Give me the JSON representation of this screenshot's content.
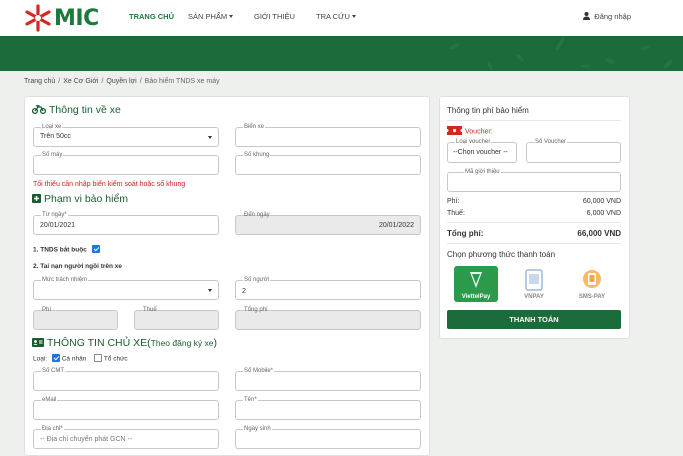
{
  "header": {
    "logo_text": "MIC",
    "nav": [
      {
        "label": "TRANG CHỦ",
        "active": true,
        "dropdown": false
      },
      {
        "label": "SẢN PHẨM",
        "active": false,
        "dropdown": true
      },
      {
        "label": "GIỚI THIỆU",
        "active": false,
        "dropdown": false
      },
      {
        "label": "TRA CỨU",
        "active": false,
        "dropdown": true
      }
    ],
    "login": "Đăng nhập"
  },
  "breadcrumb": [
    "Trang chủ",
    "Xe Cơ Giới",
    "Quyền lợi",
    "Bảo hiểm TNDS xe máy"
  ],
  "vehicle": {
    "title": "Thông tin về xe",
    "loai_xe": {
      "label": "Loại xe",
      "value": "Trên 50cc"
    },
    "bien_xe": {
      "label": "Biển xe",
      "value": ""
    },
    "so_may": {
      "label": "Số máy",
      "value": ""
    },
    "so_khung": {
      "label": "Số khung",
      "value": ""
    },
    "error": "Tối thiểu cần nhập biển kiểm soát hoặc số khung"
  },
  "scope": {
    "title": "Phạm vi bảo hiểm",
    "tu_ngay": {
      "label": "Từ ngày*",
      "value": "20/01/2021"
    },
    "den_ngay": {
      "label": "Đến ngày",
      "value": "20/01/2022"
    },
    "tnds_label": "1. TNDS bắt buộc",
    "tnds_checked": true,
    "accident_label": "2. Tai nạn người ngồi trên xe",
    "muc_trach_nhiem": {
      "label": "Mức trách nhiệm",
      "value": ""
    },
    "so_nguoi": {
      "label": "Số người",
      "value": "2"
    },
    "phi": {
      "label": "Phí",
      "value": ""
    },
    "thue": {
      "label": "Thuế",
      "value": ""
    },
    "tong_phi": {
      "label": "Tổng phí",
      "value": ""
    }
  },
  "owner": {
    "title": "THÔNG TIN CHỦ XE(",
    "title_small": "Theo đăng ký xe",
    "title_end": ")",
    "loai_label": "Loại:",
    "ca_nhan": "Cá nhân",
    "ca_nhan_checked": true,
    "to_chuc": "Tổ chức",
    "to_chuc_checked": false,
    "so_cmt": {
      "label": "Số CMT",
      "value": ""
    },
    "so_mobile": {
      "label": "Số Mobile*",
      "value": ""
    },
    "email": {
      "label": "eMail",
      "value": ""
    },
    "ten": {
      "label": "Tên*",
      "value": ""
    },
    "dia_chi": {
      "label": "Địa chỉ*",
      "placeholder": "-- Địa chỉ chuyển phát GCN --"
    },
    "ngay_sinh": {
      "label": "Ngày sinh",
      "value": ""
    }
  },
  "fee": {
    "title": "Thông tin phí bảo hiểm",
    "voucher_label": "Voucher:",
    "loai_voucher": {
      "label": "Loại voucher",
      "value": "--Chọn voucher --"
    },
    "so_voucher": {
      "label": "Số Voucher",
      "value": ""
    },
    "ma_gioi_thieu": {
      "label": "Mã giới thiệu",
      "value": ""
    },
    "phi_label": "Phí:",
    "phi_value": "60,000",
    "thue_label": "Thuế:",
    "thue_value": "6,000",
    "tong_label": "Tổng phí:",
    "tong_value": "66,000",
    "currency": "VND",
    "payment_title": "Chọn phương thức thanh toán",
    "methods": [
      {
        "label": "ViettelPay",
        "selected": true
      },
      {
        "label": "VNPAY",
        "selected": false
      },
      {
        "label": "SMS-PAY",
        "selected": false
      }
    ],
    "pay_button": "THANH TOÁN"
  },
  "colors": {
    "brand_green": "#1b6b3b",
    "logo_red": "#d7261e",
    "error_red": "#d0201f",
    "checkbox_blue": "#1e73e8"
  }
}
